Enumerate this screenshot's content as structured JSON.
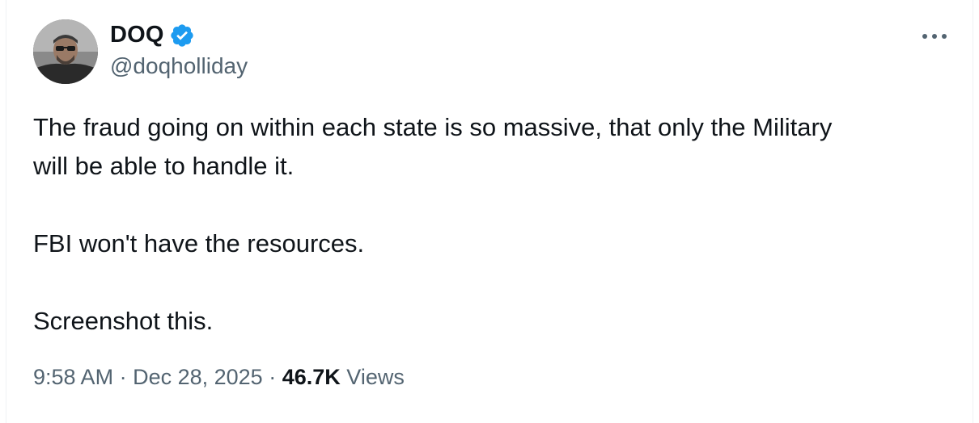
{
  "tweet": {
    "author": {
      "display_name": "DOQ",
      "handle": "@doqholliday",
      "verified": true
    },
    "lines": [
      "The fraud going on within each state is so massive, that only the Military",
      "will be able to handle it.",
      "",
      "FBI won't have the resources.",
      "",
      "Screenshot this."
    ],
    "time": "9:58 AM",
    "separator": "·",
    "date": "Dec 28, 2025",
    "views_count": "46.7K",
    "views_label": "Views"
  },
  "icons": {
    "verified": "verified-badge-icon",
    "more": "more-options-icon"
  },
  "colors": {
    "text_primary": "#0f1419",
    "text_secondary": "#536471",
    "verified_blue": "#1d9bf0",
    "border": "#eff3f4"
  }
}
